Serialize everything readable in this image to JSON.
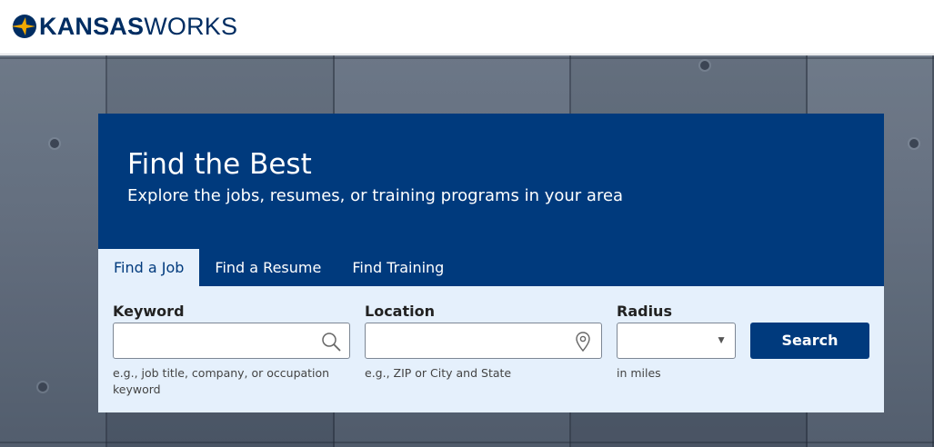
{
  "header": {
    "logo_bold": "KANSAS",
    "logo_regular": "WORKS"
  },
  "hero": {
    "title": "Find the Best",
    "subtitle": "Explore the jobs, resumes, or training programs in your area"
  },
  "tabs": [
    {
      "label": "Find a Job",
      "active": true
    },
    {
      "label": "Find a Resume",
      "active": false
    },
    {
      "label": "Find Training",
      "active": false
    }
  ],
  "form": {
    "keyword": {
      "label": "Keyword",
      "value": "",
      "hint": "e.g., job title, company, or occupation keyword",
      "icon": "search-icon"
    },
    "location": {
      "label": "Location",
      "value": "",
      "hint": "e.g., ZIP or City and State",
      "icon": "map-pin-icon"
    },
    "radius": {
      "label": "Radius",
      "value": "",
      "hint": "in miles",
      "icon": "caret-down-icon"
    },
    "search_label": "Search"
  },
  "colors": {
    "brand_navy": "#003a7d",
    "form_bg": "#e5f0fc",
    "logo_navy": "#002d62",
    "star_gold": "#f2a900"
  }
}
